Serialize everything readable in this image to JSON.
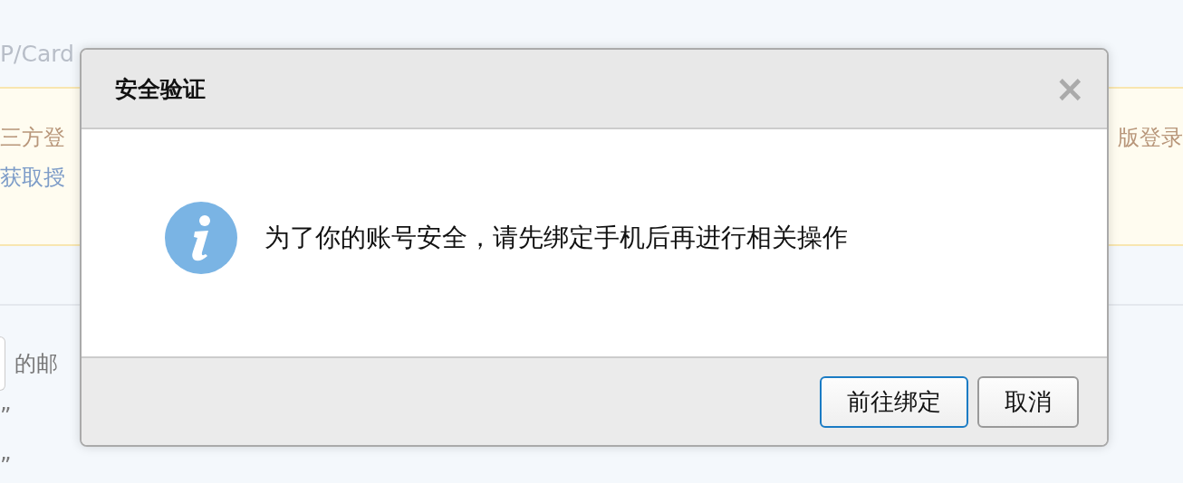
{
  "background": {
    "ssl_line": "P/Card",
    "notice": {
      "line_1_left": "三方登",
      "line_1_right": "版登录",
      "line_2_left": "获取授"
    },
    "email_label": "的邮",
    "quote_lines": [
      "”",
      "”"
    ]
  },
  "dialog": {
    "title": "安全验证",
    "close": "×",
    "message": "为了你的账号安全，请先绑定手机后再进行相关操作",
    "buttons": [
      {
        "label": "前往绑定",
        "focused": true
      },
      {
        "label": "取消",
        "focused": false
      }
    ]
  }
}
